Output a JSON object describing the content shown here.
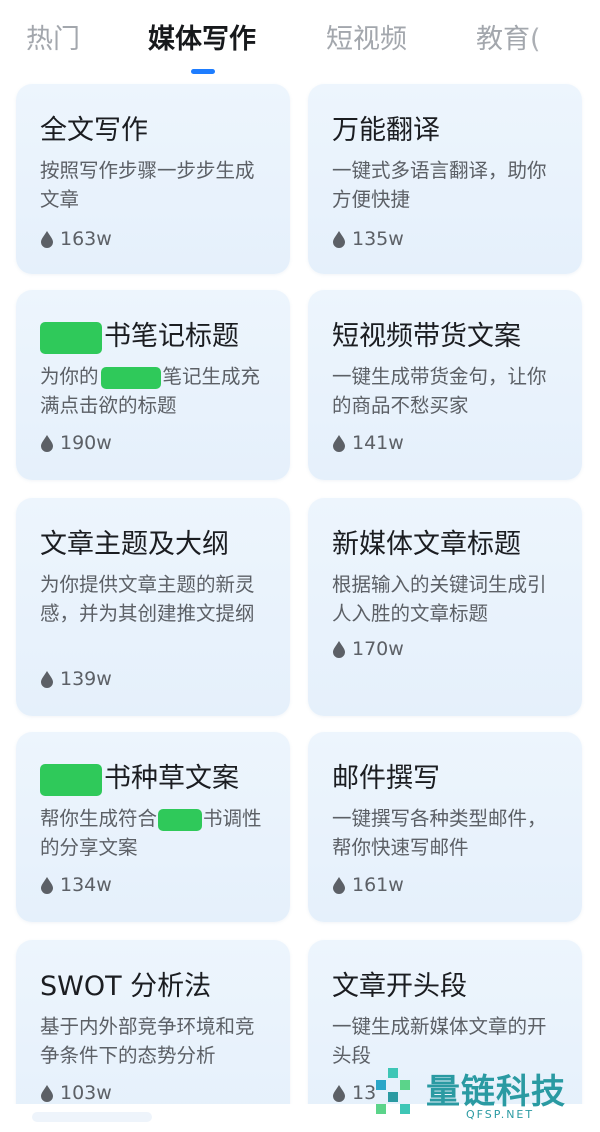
{
  "tabs": [
    {
      "label": "热门",
      "active": false
    },
    {
      "label": "媒体写作",
      "active": true
    },
    {
      "label": "短视频",
      "active": false
    },
    {
      "label": "教育(",
      "active": false
    }
  ],
  "cards": [
    {
      "title": "全文写作",
      "desc": "按照写作步骤一步步生成文章",
      "views": "163w"
    },
    {
      "title": "万能翻译",
      "desc": "一键式多语言翻译，助你方便快捷",
      "views": "135w"
    },
    {
      "title": "书笔记标题",
      "desc_before": "为你的",
      "desc_after": "笔记生成充满点击欲的标题",
      "views": "190w"
    },
    {
      "title": "短视频带货文案",
      "desc": "一键生成带货金句，让你的商品不愁买家",
      "views": "141w"
    },
    {
      "title": "文章主题及大纲",
      "desc": "为你提供文章主题的新灵感，并为其创建推文提纲",
      "views": "139w"
    },
    {
      "title": "新媒体文章标题",
      "desc": "根据输入的关键词生成引人入胜的文章标题",
      "views": "170w"
    },
    {
      "title": "书种草文案",
      "desc_before": "帮你生成符合",
      "desc_after": "书调性的分享文案",
      "views": "134w"
    },
    {
      "title": "邮件撰写",
      "desc": "一键撰写各种类型邮件，帮你快速写邮件",
      "views": "161w"
    },
    {
      "title": "SWOT 分析法",
      "desc": "基于内外部竞争环境和竞争条件下的态势分析",
      "views": "103w"
    },
    {
      "title": "文章开头段",
      "desc": "一键生成新媒体文章的开头段",
      "views": "13"
    }
  ],
  "icons": {
    "views": "flame-drop-icon"
  },
  "colors": {
    "accent": "#1e7dff",
    "card_bg": "#e9f3fc",
    "redaction": "#2fc95a"
  },
  "watermark": {
    "text": "量链科技",
    "sub": "QFSP.NET"
  }
}
